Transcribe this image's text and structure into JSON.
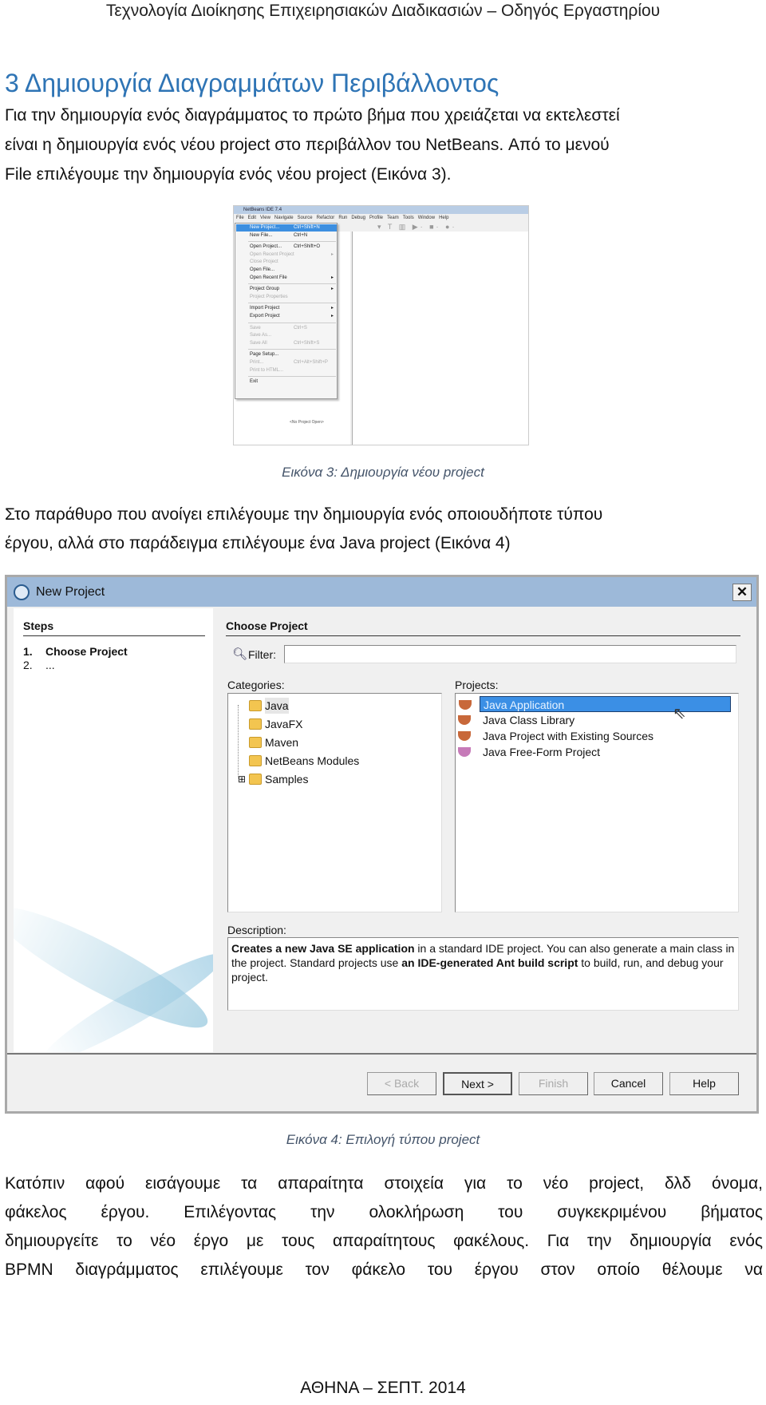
{
  "header": "Τεχνολογία Διοίκησης Επιχειρησιακών Διαδικασιών – Οδηγός Εργαστηρίου",
  "section_title": "3   Δημιουργία Διαγραμμάτων Περιβάλλοντος",
  "para1": [
    "Για την δημιουργία ενός διαγράμματος το πρώτο βήμα που χρειάζεται να εκτελεστεί",
    "είναι η δημιουργία ενός νέου project στο περιβάλλον του NetBeans. Από το μενού",
    "File επιλέγουμε την δημιουργία ενός νέου project (Εικόνα 3)."
  ],
  "figure3": {
    "window_title": "NetBeans IDE 7.4",
    "menubar": [
      "File",
      "Edit",
      "View",
      "Navigate",
      "Source",
      "Refactor",
      "Run",
      "Debug",
      "Profile",
      "Team",
      "Tools",
      "Window",
      "Help"
    ],
    "menu_items": [
      {
        "label": "New Project...",
        "shortcut": "Ctrl+Shift+N",
        "highlighted": true
      },
      {
        "label": "New File...",
        "shortcut": "Ctrl+N"
      },
      {
        "sep": true
      },
      {
        "label": "Open Project...",
        "shortcut": "Ctrl+Shift+O"
      },
      {
        "label": "Open Recent Project",
        "disabled": true,
        "submenu": true
      },
      {
        "label": "Close Project",
        "disabled": true
      },
      {
        "label": "Open File..."
      },
      {
        "label": "Open Recent File",
        "submenu": true
      },
      {
        "sep": true
      },
      {
        "label": "Project Group",
        "submenu": true
      },
      {
        "label": "Project Properties",
        "disabled": true
      },
      {
        "sep": true
      },
      {
        "label": "Import Project",
        "submenu": true
      },
      {
        "label": "Export Project",
        "submenu": true
      },
      {
        "sep": true
      },
      {
        "label": "Save",
        "shortcut": "Ctrl+S",
        "disabled": true
      },
      {
        "label": "Save As...",
        "disabled": true
      },
      {
        "label": "Save All",
        "shortcut": "Ctrl+Shift+S",
        "disabled": true
      },
      {
        "sep": true
      },
      {
        "label": "Page Setup..."
      },
      {
        "label": "Print...",
        "shortcut": "Ctrl+Alt+Shift+P",
        "disabled": true
      },
      {
        "label": "Print to HTML...",
        "disabled": true
      },
      {
        "sep": true
      },
      {
        "label": "Exit"
      }
    ],
    "no_project": "<No Project Open>",
    "caption": "Εικόνα 3: Δημιουργία νέου project"
  },
  "para2": [
    "Στο παράθυρο που ανοίγει επιλέγουμε την δημιουργία ενός οποιουδήποτε τύπου",
    "έργου, αλλά στο παράδειγμα επιλέγουμε ένα Java project (Εικόνα 4)"
  ],
  "figure4": {
    "title": "New Project",
    "close": "✕",
    "steps_title": "Steps",
    "steps": [
      {
        "num": "1.",
        "label": "Choose Project"
      },
      {
        "num": "2.",
        "label": "..."
      }
    ],
    "panel_title": "Choose Project",
    "filter_label": "Filter:",
    "filter_value": "",
    "categories_label": "Categories:",
    "categories": [
      "Java",
      "JavaFX",
      "Maven",
      "NetBeans Modules",
      "Samples"
    ],
    "projects_label": "Projects:",
    "projects": [
      "Java Application",
      "Java Class Library",
      "Java Project with Existing Sources",
      "Java Free-Form Project"
    ],
    "selected_project": "Java Application",
    "description_label": "Description:",
    "description": [
      {
        "text": "Creates a new Java SE application",
        "bold": true
      },
      {
        "text": " in a standard IDE project. You can also generate a main class in the project. Standard projects use "
      },
      {
        "text": "an IDE-generated Ant build script",
        "bold": true
      },
      {
        "text": " to build, run, and debug your project."
      }
    ],
    "buttons": {
      "back": "< Back",
      "next": "Next >",
      "finish": "Finish",
      "cancel": "Cancel",
      "help": "Help"
    },
    "caption": "Εικόνα 4: Επιλογή τύπου project"
  },
  "para3": [
    "Κατόπιν αφού εισάγουμε τα απαραίτητα στοιχεία για το νέο project, δλδ όνομα,",
    "φάκελος έργου. Επιλέγοντας την ολοκλήρωση του συγκεκριμένου βήματος",
    "δημιουργείτε το νέο έργο με τους απαραίτητους φακέλους. Για την δημιουργία ενός",
    "BPMN διαγράμματος επιλέγουμε τον φάκελο του έργου στον οποίο θέλουμε να"
  ],
  "footer": "ΑΘΗΝΑ – ΣΕΠΤ. 2014",
  "colors": {
    "heading": "#2e74b5",
    "caption": "#44546a",
    "selection": "#3b8fe5",
    "titlebar": "#9db9d9"
  }
}
